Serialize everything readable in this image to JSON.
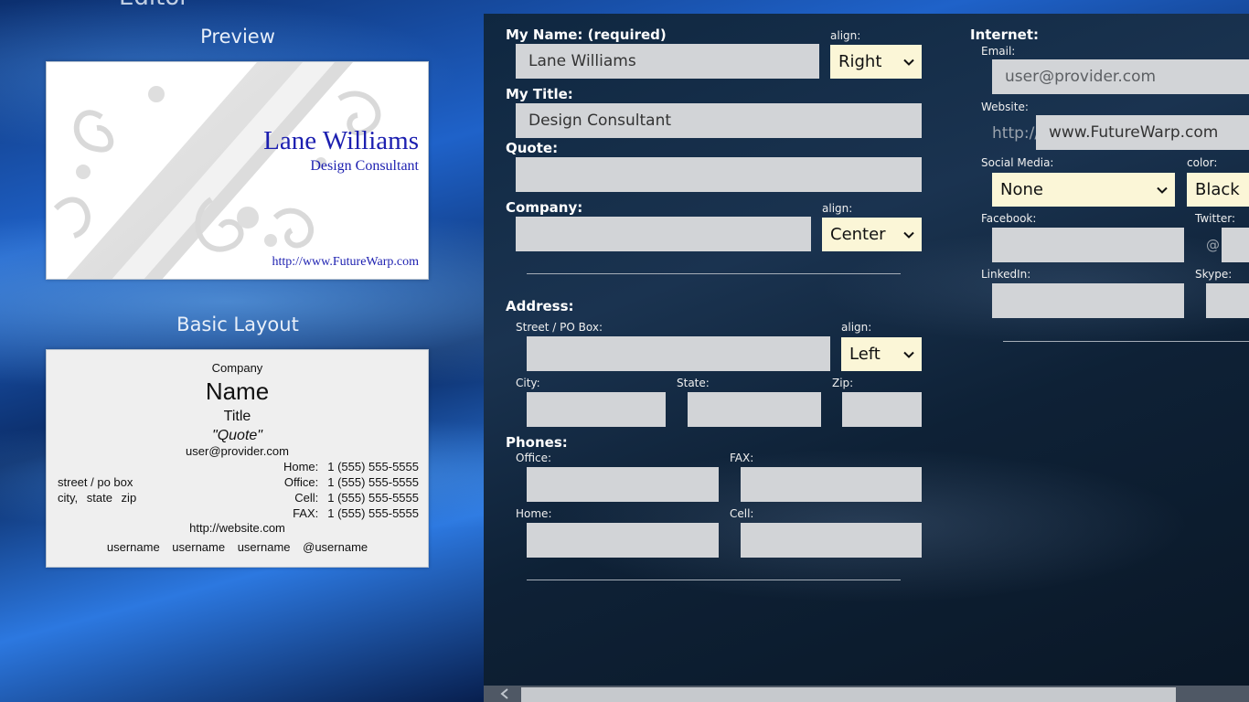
{
  "app": {
    "title": "Editor"
  },
  "preview": {
    "heading": "Preview",
    "name": "Lane Williams",
    "title": "Design Consultant",
    "website": "http://www.FutureWarp.com"
  },
  "basic_layout": {
    "heading": "Basic Layout",
    "company": "Company",
    "name": "Name",
    "title": "Title",
    "quote": "\"Quote\"",
    "email": "user@provider.com",
    "street": "street / po box",
    "city_line": "city, state zip",
    "phones": [
      {
        "label": "Home:",
        "value": "1 (555) 555-5555"
      },
      {
        "label": "Office:",
        "value": "1 (555) 555-5555"
      },
      {
        "label": "Cell:",
        "value": "1 (555) 555-5555"
      },
      {
        "label": "FAX:",
        "value": "1 (555) 555-5555"
      }
    ],
    "website": "http://website.com",
    "social": "username username username @username"
  },
  "form": {
    "name": {
      "label": "My Name: (required)",
      "value": "Lane Williams",
      "align_label": "align:",
      "align": "Right"
    },
    "title": {
      "label": "My Title:",
      "value": "Design Consultant"
    },
    "quote": {
      "label": "Quote:",
      "value": ""
    },
    "company": {
      "label": "Company:",
      "value": "",
      "align_label": "align:",
      "align": "Center"
    },
    "address": {
      "label": "Address:",
      "street_label": "Street / PO Box:",
      "align_label": "align:",
      "align": "Left",
      "city_label": "City:",
      "state_label": "State:",
      "zip_label": "Zip:"
    },
    "phones": {
      "label": "Phones:",
      "office_label": "Office:",
      "fax_label": "FAX:",
      "home_label": "Home:",
      "cell_label": "Cell:"
    },
    "internet": {
      "label": "Internet:",
      "email_label": "Email:",
      "email_placeholder": "user@provider.com",
      "website_label": "Website:",
      "website_prefix": "http://",
      "website_value": "www.FutureWarp.com",
      "social_label": "Social Media:",
      "social_value": "None",
      "color_label": "color:",
      "color_value": "Black",
      "facebook_label": "Facebook:",
      "twitter_label": "Twitter:",
      "twitter_prefix": "@",
      "linkedin_label": "LinkedIn:",
      "skype_label": "Skype:"
    }
  },
  "icons": {
    "dropdown": "chevron-down-icon",
    "scroll_left": "chevron-left-icon"
  }
}
